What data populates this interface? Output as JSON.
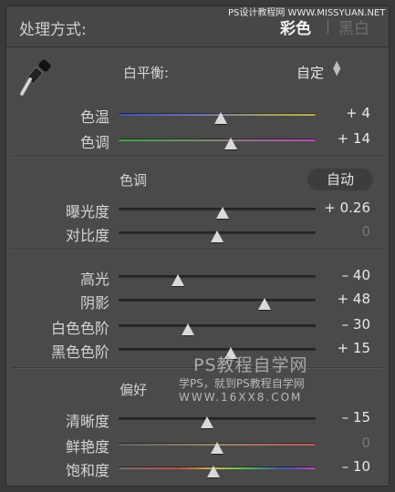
{
  "header": {
    "title": "处理方式:",
    "mode_color": "彩色",
    "mode_bw": "黑白",
    "watermark": "PS设计教程网 WWW.MISSYUAN.NET"
  },
  "white_balance": {
    "label": "白平衡:",
    "value": "自定",
    "arrows": "⌃⌄",
    "dropper_icon": "eyedropper-icon",
    "sliders": [
      {
        "label": "色温",
        "value": "+ 4",
        "position": 0.52
      },
      {
        "label": "色调",
        "value": "+ 14",
        "position": 0.57
      }
    ]
  },
  "tone": {
    "label": "色调",
    "auto_label": "自动",
    "sliders": [
      {
        "label": "曝光度",
        "value": "+ 0.26",
        "position": 0.53
      },
      {
        "label": "对比度",
        "value": "0",
        "position": 0.5
      }
    ]
  },
  "tone2": {
    "sliders": [
      {
        "label": "高光",
        "value": "– 40",
        "position": 0.3
      },
      {
        "label": "阴影",
        "value": "+ 48",
        "position": 0.74
      },
      {
        "label": "白色色阶",
        "value": "– 30",
        "position": 0.35
      },
      {
        "label": "黑色色阶",
        "value": "+ 15",
        "position": 0.57
      }
    ]
  },
  "presence": {
    "label": "偏好",
    "sliders": [
      {
        "label": "清晰度",
        "value": "– 15",
        "position": 0.45
      },
      {
        "label": "鲜艳度",
        "value": "0",
        "position": 0.5
      },
      {
        "label": "饱和度",
        "value": "– 10",
        "position": 0.48
      }
    ]
  },
  "watermark": {
    "big": "PS教程自学网",
    "line1": "学PS，就到PS教程自学网",
    "line2": "WWW.16XX8.COM"
  },
  "colors": {
    "panel": "#4a4a4a",
    "text": "#d4d4d4",
    "value_dim": "#777777"
  }
}
